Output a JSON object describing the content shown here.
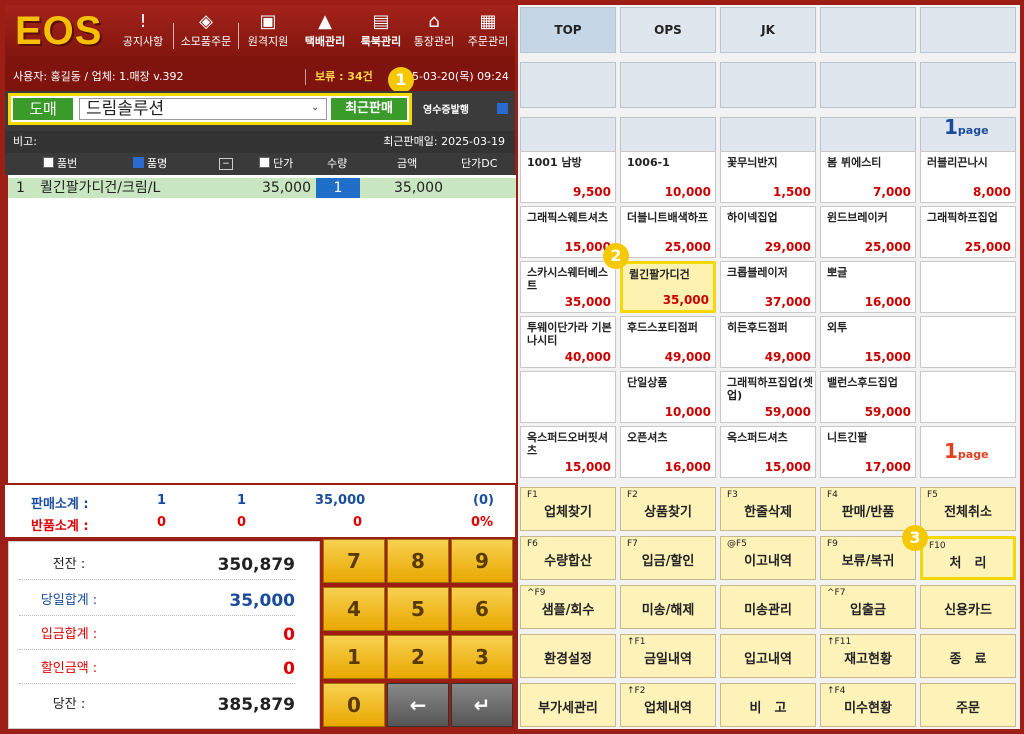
{
  "app": {
    "logo": "EOS"
  },
  "topmenu": [
    {
      "label": "공지사항",
      "icon": "!"
    },
    {
      "label": "소모품주문",
      "icon": "◈"
    },
    {
      "label": "원격지원",
      "icon": "▣"
    },
    {
      "label": "택배관리",
      "icon": "▲"
    },
    {
      "label": "룩북관리",
      "icon": "▤"
    },
    {
      "label": "통장관리",
      "icon": "⌂"
    },
    {
      "label": "주문관리",
      "icon": "▦"
    }
  ],
  "info": {
    "user": "사용자: 홍길동 / 업체: 1.매장 v.392",
    "hold": "보류 : 34건",
    "datetime": "2025-03-20(목) 09:24"
  },
  "customer": {
    "type": "도매",
    "name": "드림솔루션",
    "recent": "최근판매",
    "receipt": "영수증발행"
  },
  "note": {
    "label": "비고:",
    "last_sale": "최근판매일: 2025-03-19"
  },
  "grid": {
    "headers": [
      "품번",
      "품명",
      "단가",
      "수량",
      "금액",
      "단가DC"
    ],
    "rows": [
      {
        "no": "1",
        "name": "퀼긴팔가디건/크림/L",
        "price": "35,000",
        "qty": "1",
        "amount": "35,000"
      }
    ]
  },
  "summary": {
    "sale_label": "판매소계 :",
    "return_label": "반품소계 :",
    "sale": [
      "1",
      "1",
      "35,000",
      "(0)"
    ],
    "ret": [
      "0",
      "0",
      "0",
      "0%"
    ]
  },
  "balance": [
    {
      "label": "전잔 :",
      "value": "350,879"
    },
    {
      "label": "당일합계 :",
      "value": "35,000"
    },
    {
      "label": "입금합계 :",
      "value": "0"
    },
    {
      "label": "할인금액 :",
      "value": "0"
    },
    {
      "label": "당잔 :",
      "value": "385,879"
    }
  ],
  "keypad": [
    "7",
    "8",
    "9",
    "4",
    "5",
    "6",
    "1",
    "2",
    "3",
    "0",
    "←",
    "↵"
  ],
  "tabs": [
    "TOP",
    "OPS",
    "JK",
    "",
    ""
  ],
  "page1": "1",
  "page_label": "page",
  "products": [
    {
      "name": "1001 남방",
      "price": "9,500"
    },
    {
      "name": "1006-1",
      "price": "10,000"
    },
    {
      "name": "꽃무늬반지",
      "price": "1,500"
    },
    {
      "name": "봄 뷔에스티",
      "price": "7,000"
    },
    {
      "name": "러블리끈나시",
      "price": "8,000"
    },
    {
      "name": "그래픽스웨트셔츠",
      "price": "15,000"
    },
    {
      "name": "더블니트배색하프",
      "price": "25,000"
    },
    {
      "name": "하이넥집업",
      "price": "29,000"
    },
    {
      "name": "윈드브레이커",
      "price": "25,000"
    },
    {
      "name": "그래픽하프집업",
      "price": "25,000"
    },
    {
      "name": "스카시스웨터베스트",
      "price": "35,000"
    },
    {
      "name": "퀼긴팔가디건",
      "price": "35,000"
    },
    {
      "name": "크롭블레이저",
      "price": "37,000"
    },
    {
      "name": "뽀글",
      "price": "16,000"
    },
    {
      "name": "",
      "price": ""
    },
    {
      "name": "투웨이단가라 기본나시티",
      "price": "40,000"
    },
    {
      "name": "후드스포티점퍼",
      "price": "49,000"
    },
    {
      "name": "히든후드점퍼",
      "price": "49,000"
    },
    {
      "name": "외투",
      "price": "15,000"
    },
    {
      "name": "",
      "price": ""
    },
    {
      "name": "",
      "price": ""
    },
    {
      "name": "단일상품",
      "price": "10,000"
    },
    {
      "name": "그래픽하프집업(셋업)",
      "price": "59,000"
    },
    {
      "name": "밸런스후드집업",
      "price": "59,000"
    },
    {
      "name": "",
      "price": ""
    },
    {
      "name": "옥스퍼드오버핏셔츠",
      "price": "15,000"
    },
    {
      "name": "오픈셔츠",
      "price": "16,000"
    },
    {
      "name": "옥스퍼드셔츠",
      "price": "15,000"
    },
    {
      "name": "니트긴팔",
      "price": "17,000"
    },
    {
      "name": "",
      "price": ""
    }
  ],
  "fkeys": [
    {
      "k": "F1",
      "l": "업체찾기"
    },
    {
      "k": "F2",
      "l": "상품찾기"
    },
    {
      "k": "F3",
      "l": "한줄삭제"
    },
    {
      "k": "F4",
      "l": "판매/반품"
    },
    {
      "k": "F5",
      "l": "전체취소"
    },
    {
      "k": "F6",
      "l": "수량합산"
    },
    {
      "k": "F7",
      "l": "입금/할인"
    },
    {
      "k": "@F5",
      "l": "이고내역"
    },
    {
      "k": "F9",
      "l": "보류/복귀"
    },
    {
      "k": "F10",
      "l": "처　리"
    },
    {
      "k": "^F9",
      "l": "샘플/회수"
    },
    {
      "k": "",
      "l": "미송/해제"
    },
    {
      "k": "",
      "l": "미송관리"
    },
    {
      "k": "^F7",
      "l": "입출금"
    },
    {
      "k": "",
      "l": "신용카드"
    },
    {
      "k": "",
      "l": "환경설정"
    },
    {
      "k": "↑F1",
      "l": "금일내역"
    },
    {
      "k": "",
      "l": "입고내역"
    },
    {
      "k": "↑F11",
      "l": "재고현황"
    },
    {
      "k": "",
      "l": "종　료"
    },
    {
      "k": "",
      "l": "부가세관리"
    },
    {
      "k": "↑F2",
      "l": "업체내역"
    },
    {
      "k": "",
      "l": "비　고"
    },
    {
      "k": "↑F4",
      "l": "미수현황"
    },
    {
      "k": "",
      "l": "주문"
    }
  ],
  "badges": [
    "1",
    "2",
    "3"
  ]
}
